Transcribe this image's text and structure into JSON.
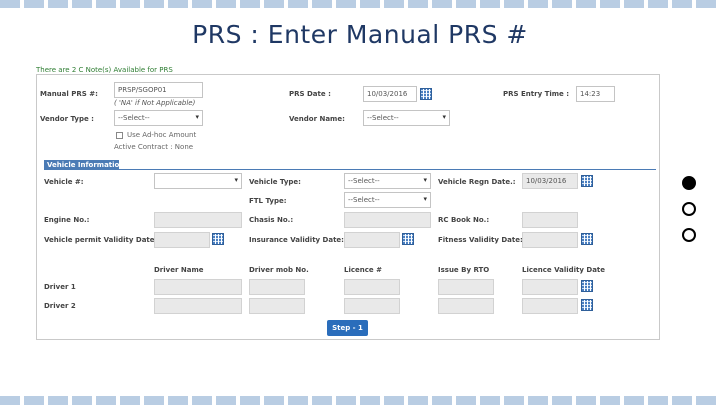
{
  "slide": {
    "title": "PRS : Enter Manual PRS #",
    "bullets": [
      "filled",
      "empty",
      "empty"
    ]
  },
  "form": {
    "note": "There are 2 C Note(s) Available for PRS",
    "manual_prs_label": "Manual PRS #:",
    "manual_prs_value": "PRSP/SGOP01",
    "manual_prs_hint": "( 'NA' if Not Applicable)",
    "prs_date_label": "PRS Date :",
    "prs_date_value": "10/03/2016",
    "prs_entry_time_label": "PRS Entry Time :",
    "prs_entry_time_value": "14:23",
    "vendor_type_label": "Vendor Type :",
    "vendor_type_value": "--Select--",
    "vendor_name_label": "Vendor Name:",
    "vendor_name_value": "--Select--",
    "adhoc_label": "Use Ad-hoc Amount",
    "active_contract_label": "Active Contract : None",
    "vehicle_section": "Vehicle Information",
    "vehicle_label": "Vehicle #:",
    "vehicle_value": "",
    "vehicle_type_label": "Vehicle Type:",
    "vehicle_type_value": "--Select--",
    "vehicle_regn_date_label": "Vehicle Regn Date.:",
    "vehicle_regn_date_value": "10/03/2016",
    "ftl_type_label": "FTL Type:",
    "ftl_type_value": "--Select--",
    "engine_no_label": "Engine No.:",
    "chasis_no_label": "Chasis No.:",
    "rc_book_no_label": "RC Book No.:",
    "permit_validity_label": "Vehicle permit Validity Date:",
    "insurance_validity_label": "Insurance Validity Date:",
    "fitness_validity_label": "Fitness Validity Date:",
    "driver_headers": [
      "Driver Name",
      "Driver mob No.",
      "Licence #",
      "Issue By RTO",
      "Licence Validity Date"
    ],
    "driver_rows": [
      "Driver 1",
      "Driver 2"
    ],
    "step_button": "Step - 1"
  }
}
